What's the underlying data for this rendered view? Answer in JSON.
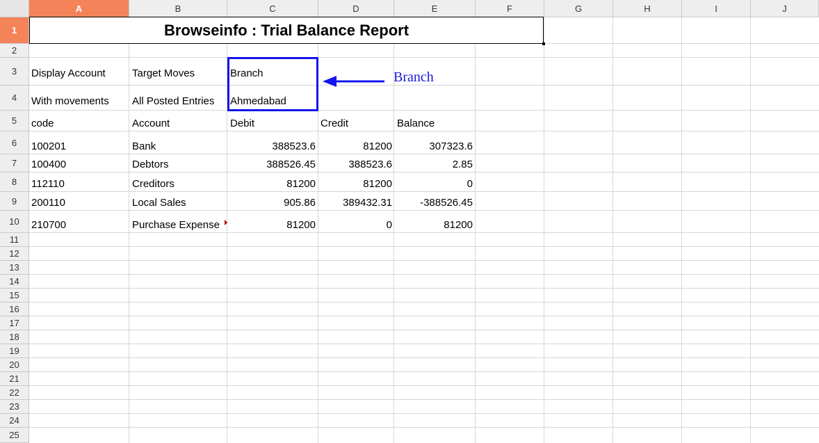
{
  "columns": [
    "A",
    "B",
    "C",
    "D",
    "E",
    "F",
    "G",
    "H",
    "I",
    "J"
  ],
  "selected_column": "A",
  "selected_row": "1",
  "rows": [
    "1",
    "2",
    "3",
    "4",
    "5",
    "6",
    "7",
    "8",
    "9",
    "10",
    "11",
    "12",
    "13",
    "14",
    "15",
    "16",
    "17",
    "18",
    "19",
    "20",
    "21",
    "22",
    "23",
    "24",
    "25"
  ],
  "title": "Browseinfo : Trial Balance Report",
  "filters": {
    "display_account_label": "Display Account",
    "display_account_value": "With movements",
    "target_moves_label": "Target Moves",
    "target_moves_value": "All Posted Entries",
    "branch_label": "Branch",
    "branch_value": "Ahmedabad"
  },
  "table": {
    "headers": [
      "code",
      "Account",
      "Debit",
      "Credit",
      "Balance"
    ],
    "rows": [
      [
        "100201",
        "Bank",
        "388523.6",
        "81200",
        "307323.6"
      ],
      [
        "100400",
        "Debtors",
        "388526.45",
        "388523.6",
        "2.85"
      ],
      [
        "112110",
        "Creditors",
        "81200",
        "81200",
        "0"
      ],
      [
        "200110",
        "Local Sales",
        "905.86",
        "389432.31",
        "-388526.45"
      ],
      [
        "210700",
        "Purchase Expense",
        "81200",
        "0",
        "81200"
      ]
    ]
  },
  "annotation": {
    "label": "Branch",
    "color": "#1a1ad8"
  },
  "colors": {
    "selected_header": "#f4835a",
    "highlight_box": "#1414ee"
  }
}
